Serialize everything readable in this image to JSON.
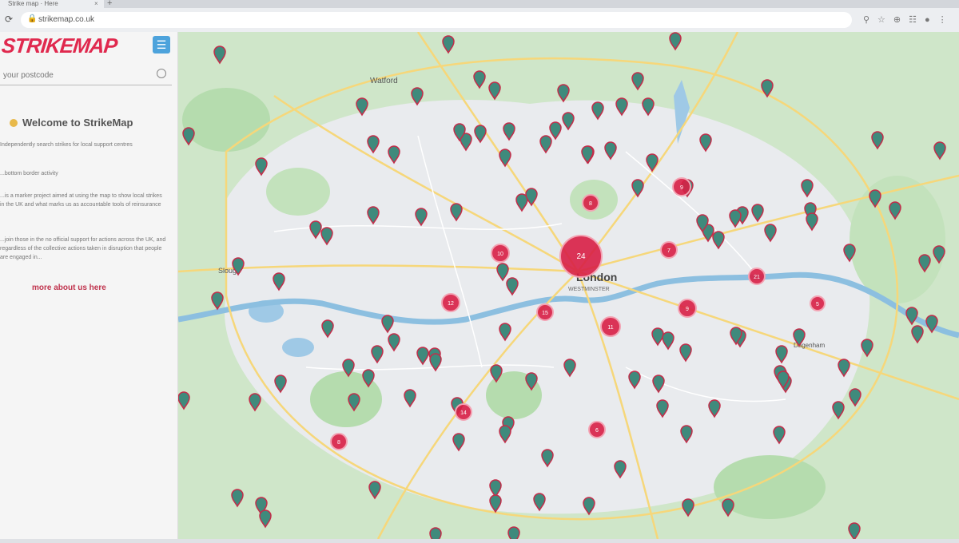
{
  "browser": {
    "tab_title": "Strike map · Here",
    "url": "strikemap.co.uk"
  },
  "sidebar": {
    "logo": "STRIKEMAP",
    "search_placeholder": "your postcode",
    "welcome_title": "Welcome to StrikeMap",
    "paragraphs": [
      "Independently search strikes for local support centres",
      "...bottom border activity",
      "...is a marker project aimed at using the map to show local strikes in the UK and what marks us as accountable tools of reinsurance",
      "...join those in the no official support for actions across the UK, and regardless of the collective actions taken in disruption that people are engaged in..."
    ],
    "learn_more": "more about us here"
  },
  "map": {
    "labels": [
      {
        "text": "Watford"
      },
      {
        "text": "London"
      },
      {
        "text": "WESTMINSTER"
      },
      {
        "text": "Slough"
      },
      {
        "text": "Dagenham"
      }
    ],
    "clusters": [
      {
        "count": "24"
      },
      {
        "count": "8"
      },
      {
        "count": "9"
      },
      {
        "count": "10"
      },
      {
        "count": "12"
      },
      {
        "count": "7"
      },
      {
        "count": "15"
      },
      {
        "count": "11"
      },
      {
        "count": "9"
      },
      {
        "count": "21"
      },
      {
        "count": "14"
      },
      {
        "count": "6"
      },
      {
        "count": "8"
      },
      {
        "count": "5"
      }
    ]
  },
  "colors": {
    "brand": "#e0294e",
    "marker": "#3f8a7c",
    "marker_outline": "#c42c49",
    "cluster": "#d81f45",
    "accent_button": "#4da3dc"
  }
}
